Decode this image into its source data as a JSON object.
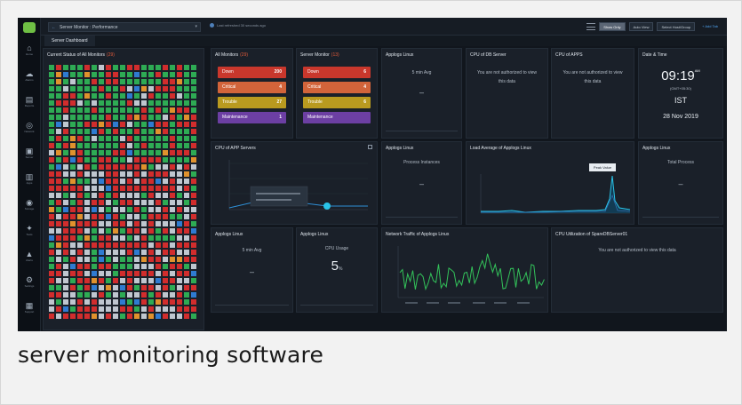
{
  "caption": "server monitoring software",
  "colors": {
    "up": "#2eab54",
    "down": "#d12d2d",
    "trouble": "#e0922d",
    "critical": "#2f7bd1",
    "maint": "#bfc6cf",
    "accent": "#29c4e8",
    "traffic": "#33c25a"
  },
  "topbar": {
    "breadcrumb": "Server Monitor : Performance",
    "refresh_text": "Last refreshed 30 seconds ago",
    "btn_views": "Show Only",
    "btn_mode": "Auto View",
    "btn_select": "Select Host/Group",
    "link_tab": "+ Add Tab"
  },
  "subtab": "Server Dashboard",
  "sidenav": [
    {
      "icon": "home-icon",
      "glyph": "⌂",
      "label": "Home"
    },
    {
      "icon": "alarm-icon",
      "glyph": "☁",
      "label": "Alarms"
    },
    {
      "icon": "reports-icon",
      "glyph": "▤",
      "label": "Reports"
    },
    {
      "icon": "network-icon",
      "glyph": "◎",
      "label": "Network"
    },
    {
      "icon": "server-icon",
      "glyph": "▣",
      "label": "Server"
    },
    {
      "icon": "apps-icon",
      "glyph": "▥",
      "label": "Apps"
    },
    {
      "icon": "storage-icon",
      "glyph": "◉",
      "label": "Storage"
    },
    {
      "icon": "tools-icon",
      "glyph": "✦",
      "label": "Tools"
    },
    {
      "icon": "alert-icon",
      "glyph": "▲",
      "label": "Alerts"
    },
    {
      "icon": "settings-icon",
      "glyph": "⚙",
      "label": "Settings"
    },
    {
      "icon": "support-icon",
      "glyph": "▦",
      "label": "Support"
    }
  ],
  "heatmap": {
    "title": "Current Status of All Monitors",
    "link": "(29)"
  },
  "all_monitors": {
    "title": "All Monitors",
    "link": "(29)",
    "rows": [
      {
        "label": "Down",
        "value": "200"
      },
      {
        "label": "Critical",
        "value": "4"
      },
      {
        "label": "Trouble",
        "value": "27"
      },
      {
        "label": "Maintenance",
        "value": "1"
      }
    ]
  },
  "server_monitor": {
    "title": "Server Monitor",
    "link": "(13)",
    "rows": [
      {
        "label": "Down",
        "value": "6"
      },
      {
        "label": "Critical",
        "value": "4"
      },
      {
        "label": "Trouble",
        "value": "6"
      },
      {
        "label": "Maintenance",
        "value": ""
      }
    ]
  },
  "applogs1": {
    "title": "Applogs Linux",
    "value": "5 min Avg",
    "sub": "–"
  },
  "cpu_db": {
    "title": "CPU of DB Server",
    "msg": "You are not authorized to view this data"
  },
  "cpu_apps": {
    "title": "CPU of APPS",
    "msg": "You are not authorized to view this data"
  },
  "datetime": {
    "title": "Date & Time",
    "time": "09:19",
    "ampm": "AM",
    "tz_note": "(GMT+05:30)",
    "tz": "IST",
    "date": "28 Nov 2019"
  },
  "cpu_app": {
    "title": "CPU of APP Servers"
  },
  "applogs2": {
    "title": "Applogs Linux",
    "label": "Process Instances",
    "value": "–"
  },
  "load_avg": {
    "title": "Load Average of Applogs Linux",
    "badge": "Peak Value"
  },
  "applogs3": {
    "title": "Applogs Linux",
    "label": "Total Process",
    "value": "–"
  },
  "applogs4": {
    "title": "Applogs Linux",
    "value": "5 min Avg",
    "sub": "–"
  },
  "applogs5": {
    "title": "Applogs Linux",
    "label": "CPU Usage",
    "value": "5",
    "unit": "%"
  },
  "traffic": {
    "title": "Network Traffic of Applogs Linux"
  },
  "cpu_spare": {
    "title": "CPU Utilization of SpareDBServer01",
    "msg": "You are not authorized to view this data"
  }
}
